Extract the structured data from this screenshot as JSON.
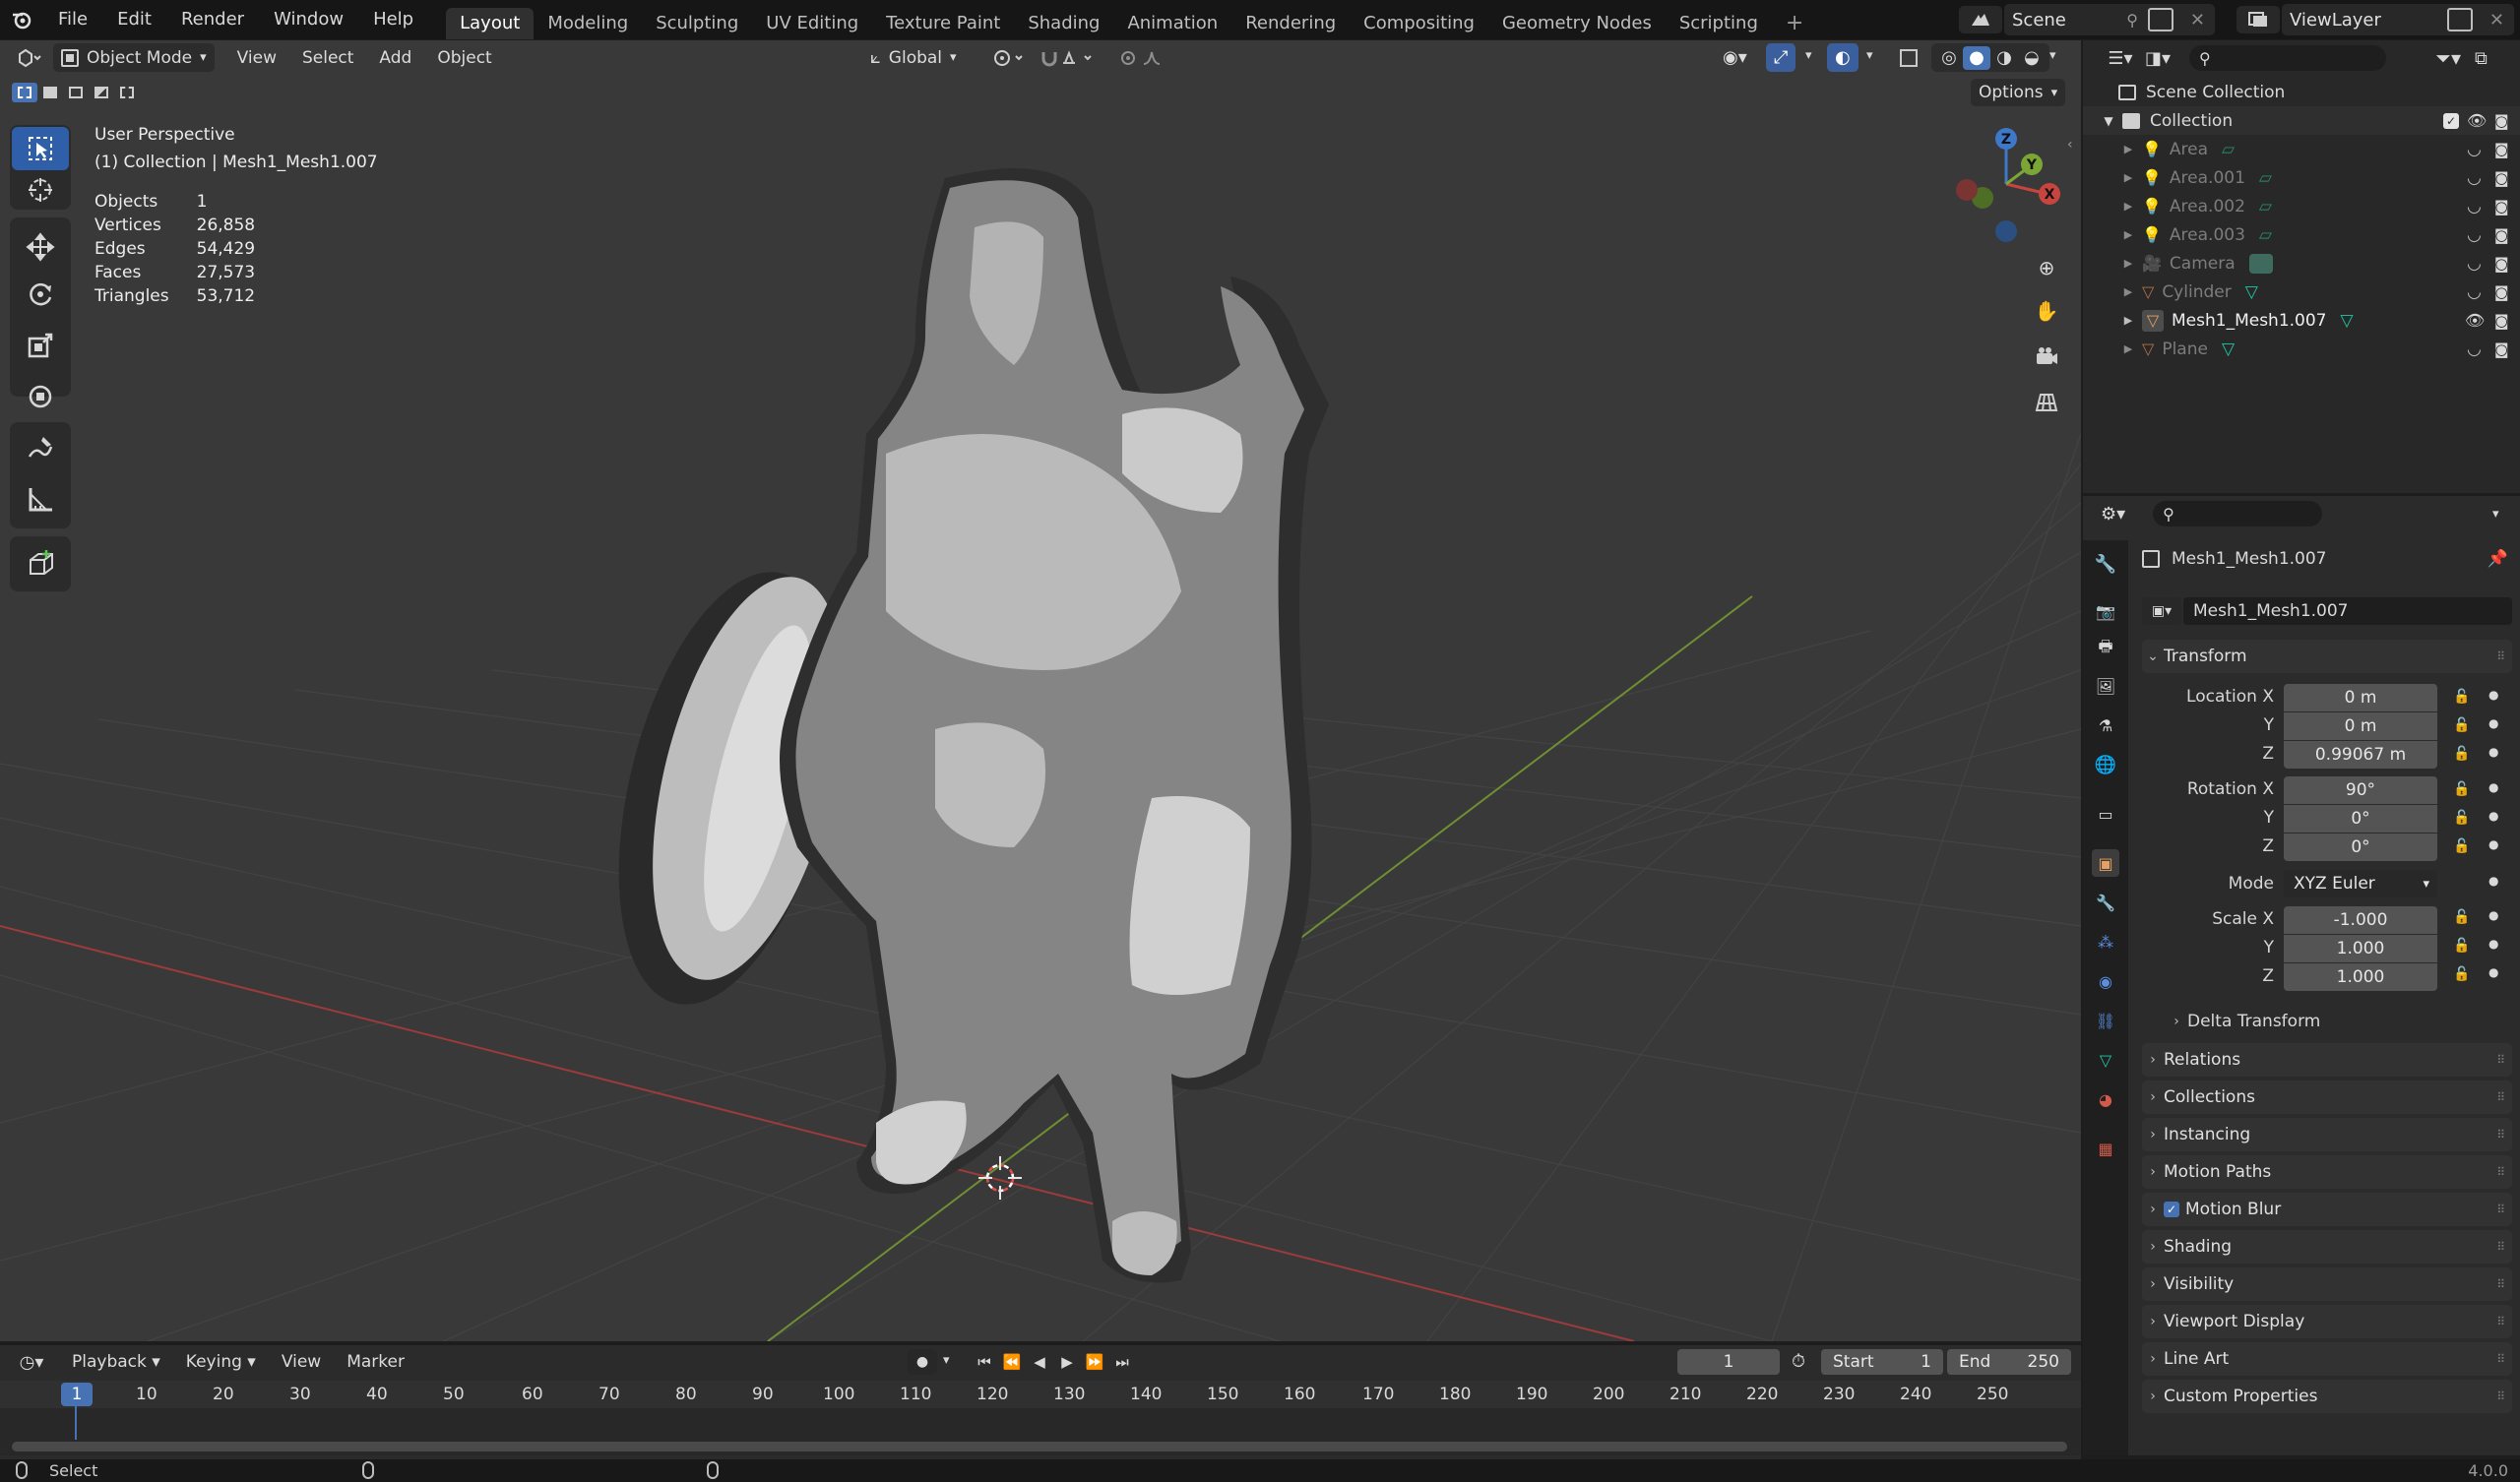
{
  "menus": [
    "File",
    "Edit",
    "Render",
    "Window",
    "Help"
  ],
  "workspaces": [
    "Layout",
    "Modeling",
    "Sculpting",
    "UV Editing",
    "Texture Paint",
    "Shading",
    "Animation",
    "Rendering",
    "Compositing",
    "Geometry Nodes",
    "Scripting"
  ],
  "active_workspace": "Layout",
  "add_workspace": "+",
  "scene": "Scene",
  "view_layer": "ViewLayer",
  "viewport": {
    "mode": "Object Mode",
    "menus": [
      "View",
      "Select",
      "Add",
      "Object"
    ],
    "transform_orientation": "Global",
    "options": "Options",
    "perspective": "User Perspective",
    "collection_info": "(1) Collection | Mesh1_Mesh1.007",
    "stats": [
      {
        "label": "Objects",
        "value": "1"
      },
      {
        "label": "Vertices",
        "value": "26,858"
      },
      {
        "label": "Edges",
        "value": "54,429"
      },
      {
        "label": "Faces",
        "value": "27,573"
      },
      {
        "label": "Triangles",
        "value": "53,712"
      }
    ],
    "gizmo_axes": {
      "x": "X",
      "y": "Y",
      "z": "Z"
    }
  },
  "outliner": {
    "root": "Scene Collection",
    "collection": "Collection",
    "items": [
      {
        "name": "Area",
        "type": "light"
      },
      {
        "name": "Area.001",
        "type": "light"
      },
      {
        "name": "Area.002",
        "type": "light"
      },
      {
        "name": "Area.003",
        "type": "light"
      },
      {
        "name": "Camera",
        "type": "camera"
      },
      {
        "name": "Cylinder",
        "type": "mesh"
      },
      {
        "name": "Mesh1_Mesh1.007",
        "type": "mesh",
        "selected": true
      },
      {
        "name": "Plane",
        "type": "mesh"
      }
    ]
  },
  "properties": {
    "object_name": "Mesh1_Mesh1.007",
    "data_name": "Mesh1_Mesh1.007",
    "transform_title": "Transform",
    "location_label": "Location X",
    "rotation_label": "Rotation X",
    "scale_label": "Scale X",
    "mode_label": "Mode",
    "y_label": "Y",
    "z_label": "Z",
    "location": [
      "0 m",
      "0 m",
      "0.99067 m"
    ],
    "rotation": [
      "90°",
      "0°",
      "0°"
    ],
    "rotation_mode": "XYZ Euler",
    "scale": [
      "-1.000",
      "1.000",
      "1.000"
    ],
    "delta_transform": "Delta Transform",
    "panels": [
      "Relations",
      "Collections",
      "Instancing",
      "Motion Paths",
      "Motion Blur",
      "Shading",
      "Visibility",
      "Viewport Display",
      "Line Art",
      "Custom Properties"
    ]
  },
  "timeline": {
    "menus": [
      "Playback",
      "Keying",
      "View",
      "Marker"
    ],
    "current_frame": "1",
    "start_label": "Start",
    "start": "1",
    "end_label": "End",
    "end": "250",
    "ticks": [
      "1",
      "10",
      "20",
      "30",
      "40",
      "50",
      "60",
      "70",
      "80",
      "90",
      "100",
      "110",
      "120",
      "130",
      "140",
      "150",
      "160",
      "170",
      "180",
      "190",
      "200",
      "210",
      "220",
      "230",
      "240",
      "250"
    ]
  },
  "status": {
    "left": "Select",
    "version": "4.0.0"
  },
  "colors": {
    "accent": "#4772b3",
    "viewport_bg": "#393939",
    "x_axis": "#c8453f",
    "y_axis": "#7ba635",
    "z_axis": "#3d78c9",
    "mesh_green": "#20c9a6"
  }
}
